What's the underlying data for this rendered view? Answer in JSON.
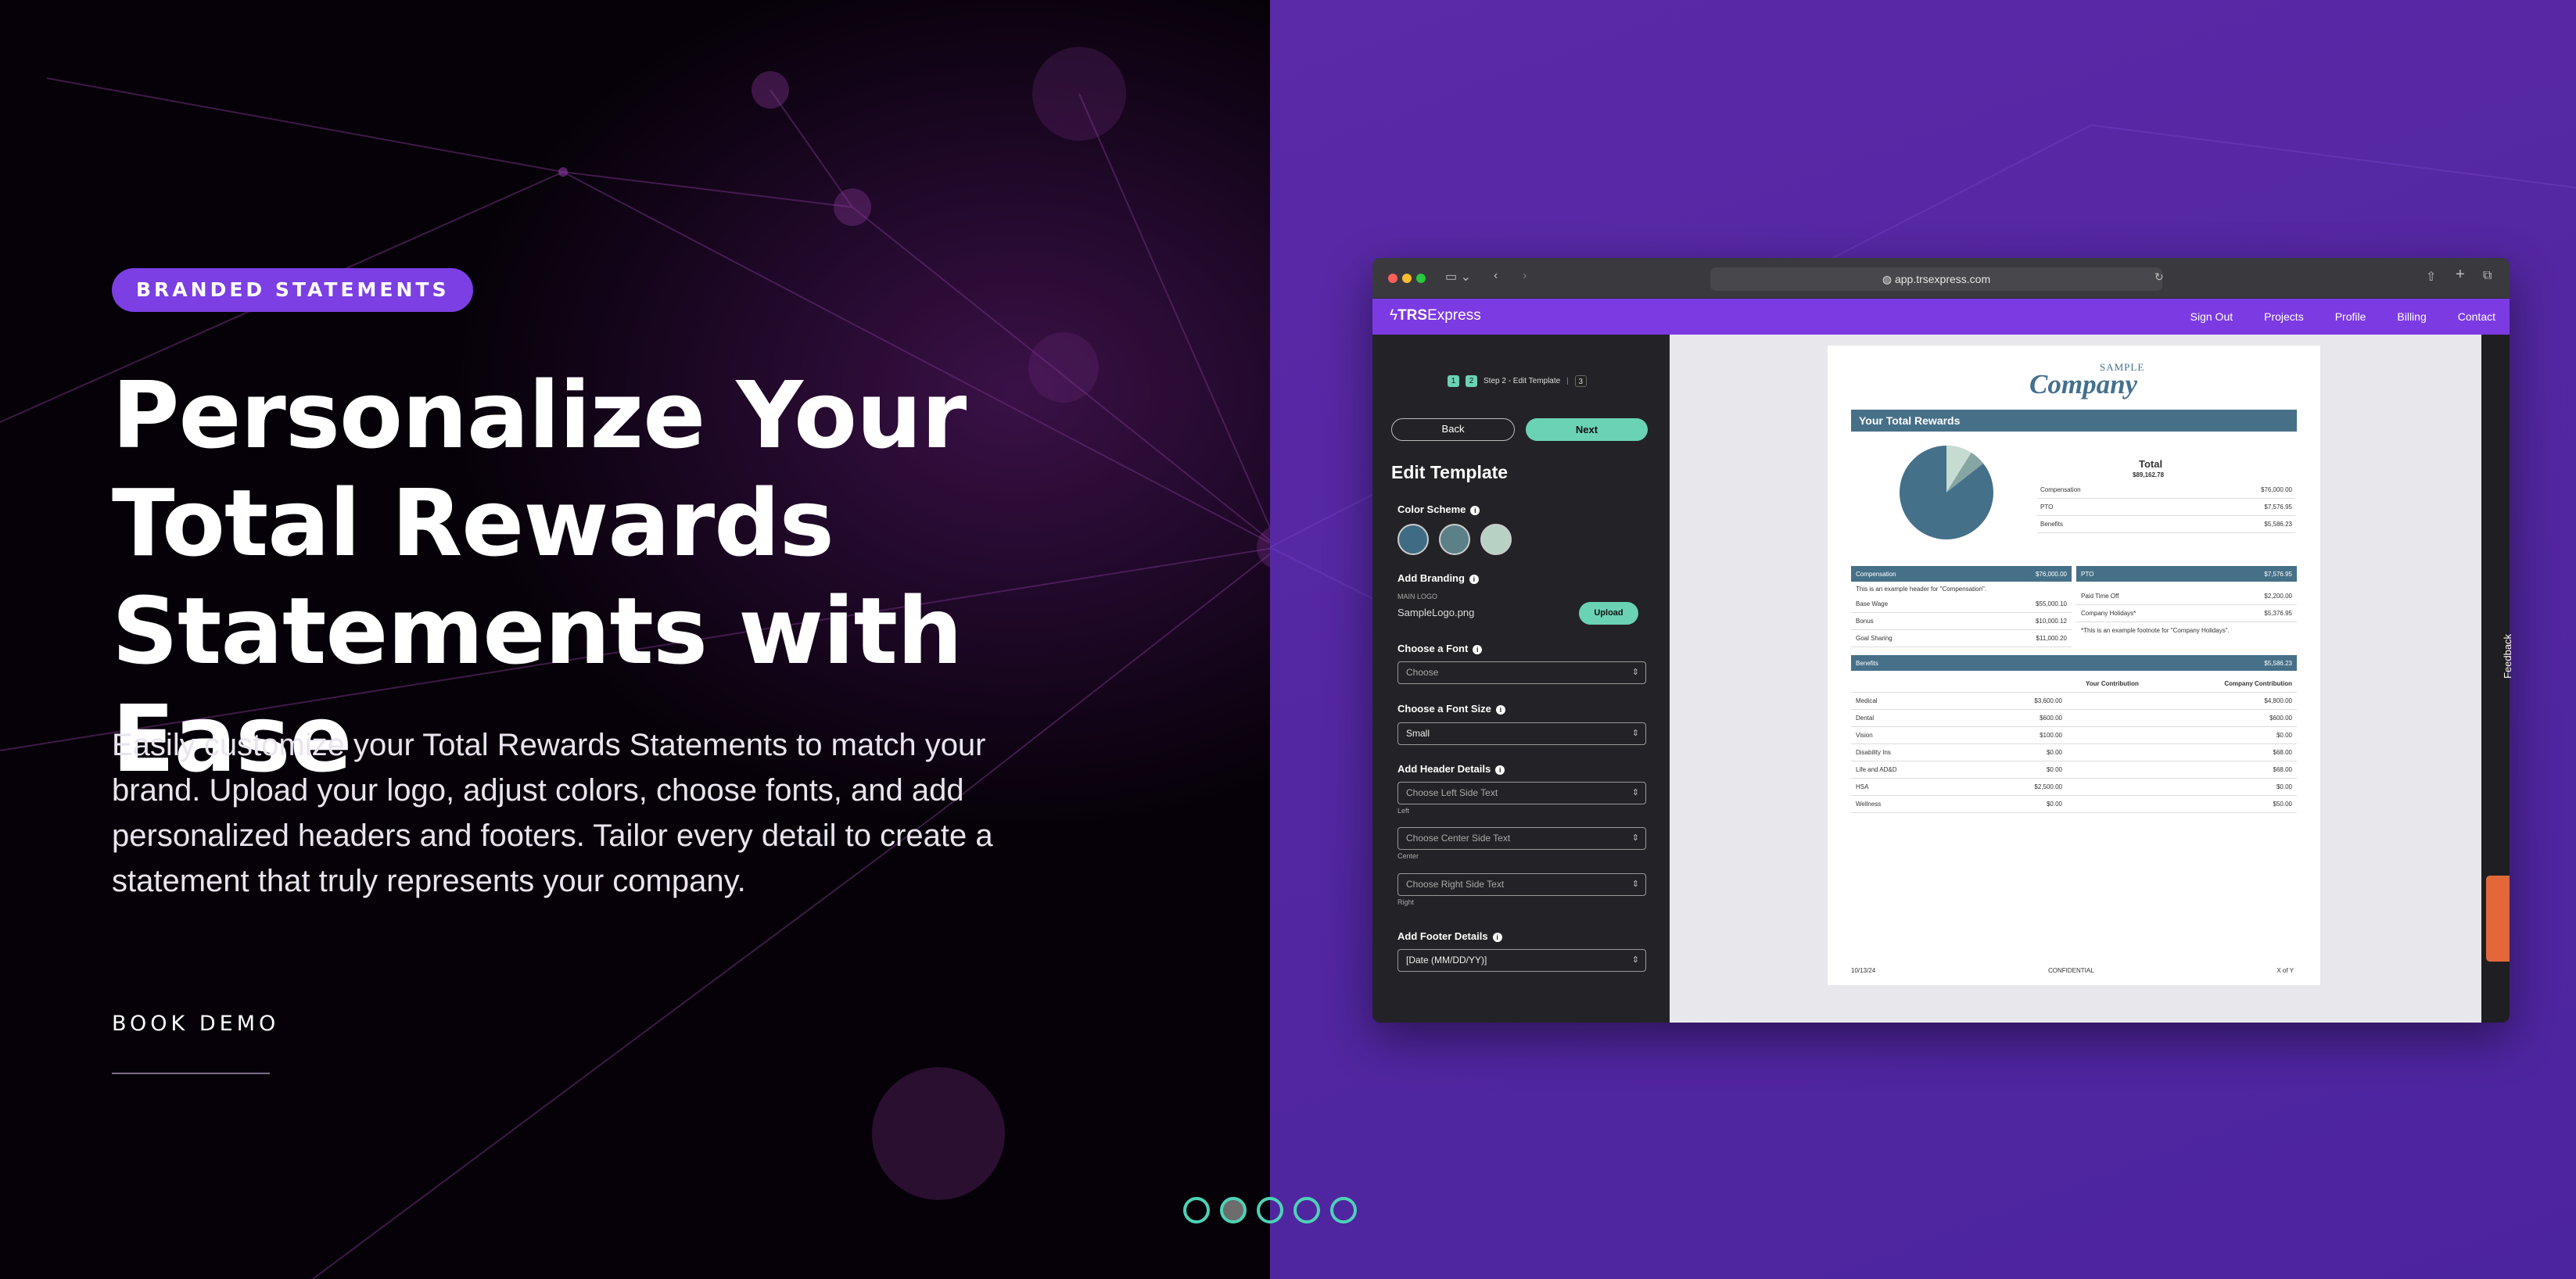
{
  "hero": {
    "badge": "BRANDED STATEMENTS",
    "title": "Personalize Your Total Rewards Statements with Ease",
    "description": "Easily customize your Total Rewards Statements to match your brand. Upload your logo, adjust colors, choose fonts, and add personalized headers and footers. Tailor every detail to create a statement that truly represents your company.",
    "cta": "BOOK DEMO",
    "slides": [
      {
        "state": "inactive"
      },
      {
        "state": "active"
      },
      {
        "state": "inactive"
      },
      {
        "state": "inactive"
      },
      {
        "state": "inactive"
      }
    ]
  },
  "browser": {
    "url": "app.trsexpress.com"
  },
  "app": {
    "logo_bold": "TRS",
    "logo_rest": "Express",
    "nav": [
      "Sign Out",
      "Projects",
      "Profile",
      "Billing",
      "Contact"
    ],
    "steps": {
      "s1": "1",
      "s2": "2",
      "label": "Step 2 - Edit Template",
      "s3": "3"
    },
    "back": "Back",
    "next": "Next",
    "edit_title": "Edit Template",
    "color_scheme_label": "Color Scheme",
    "swatches": [
      "#3f6b85",
      "#5b8088",
      "#b7d2c5"
    ],
    "branding_label": "Add Branding",
    "main_logo_label": "MAIN LOGO",
    "logo_file": "SampleLogo.png",
    "upload": "Upload",
    "font_label": "Choose a Font",
    "font_value": "Choose",
    "font_size_label": "Choose a Font Size",
    "font_size_value": "Small",
    "header_label": "Add Header Details",
    "header_left": "Choose Left Side Text",
    "header_left_caption": "Left",
    "header_center": "Choose Center Side Text",
    "header_center_caption": "Center",
    "header_right": "Choose Right Side Text",
    "header_right_caption": "Right",
    "footer_label": "Add Footer Details",
    "footer_value": "[Date (MM/DD/YY)]",
    "feedback": "Feedback"
  },
  "statement": {
    "logo_small": "SAMPLE",
    "logo_big": "Company",
    "title": "Your Total Rewards",
    "total_label": "Total",
    "total_value": "$89,162.78",
    "legend": [
      {
        "label": "Compensation",
        "value": "$76,000.00",
        "color": "#44708a"
      },
      {
        "label": "PTO",
        "value": "$7,576.95",
        "color": "#85a6a3"
      },
      {
        "label": "Benefits",
        "value": "$5,586.23",
        "color": "#c6dbd1"
      }
    ],
    "comp_header": "Compensation",
    "comp_total": "$76,000.00",
    "comp_note": "This is an example header for \"Compensation\".",
    "comp_rows": [
      [
        "Base Wage",
        "$55,000.10"
      ],
      [
        "Bonus",
        "$10,000.12"
      ],
      [
        "Goal Sharing",
        "$11,000.20"
      ]
    ],
    "pto_header": "PTO",
    "pto_total": "$7,576.95",
    "pto_rows": [
      [
        "Paid Time Off",
        "$2,200.00"
      ],
      [
        "Company Holidays*",
        "$5,376.95"
      ]
    ],
    "pto_note": "*This is an example footnote for \"Company Holidays\".",
    "ben_header": "Benefits",
    "ben_total": "$5,586.23",
    "ben_cols": [
      "Your Contribution",
      "Company Contribution"
    ],
    "ben_rows": [
      [
        "Medical",
        "$3,600.00",
        "$4,800.00"
      ],
      [
        "Dental",
        "$600.00",
        "$600.00"
      ],
      [
        "Vision",
        "$100.00",
        "$0.00"
      ],
      [
        "Disability Ins",
        "$0.00",
        "$68.00"
      ],
      [
        "Life and AD&D",
        "$0.00",
        "$68.00"
      ],
      [
        "HSA",
        "$2,500.00",
        "$0.00"
      ],
      [
        "Wellness",
        "$0.00",
        "$50.00"
      ]
    ],
    "footer_left": "10/13/24",
    "footer_center": "CONFIDENTIAL",
    "footer_right": "X of Y"
  }
}
